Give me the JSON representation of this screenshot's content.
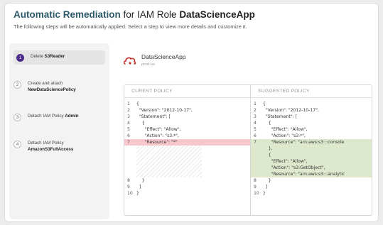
{
  "header": {
    "title_prefix": "Automatic Remediation",
    "title_middle": " for IAM Role ",
    "title_entity": "DataScienceApp",
    "subtitle": "The following steps will be automatically applied. Select a step to view more details and customize it."
  },
  "steps": [
    {
      "num": "1",
      "text": "Delete ",
      "bold": "S3Reader",
      "active": true
    },
    {
      "num": "2",
      "text": "Create and attach",
      "bold": "NewDataSciencePolicy",
      "active": false
    },
    {
      "num": "3",
      "text": "Detach IAM Policy ",
      "bold": "Admin",
      "active": false
    },
    {
      "num": "4",
      "text": "Detach IAM Policy",
      "bold": "AmazonS3FullAccess",
      "active": false
    }
  ],
  "app": {
    "name": "DataScienceApp",
    "region": "prod-us",
    "icon": "cloud-role-icon"
  },
  "current_policy": {
    "label": "CURENT POLICY",
    "lines": [
      {
        "n": "1",
        "t": "{"
      },
      {
        "n": "2",
        "t": "  \"Version\": \"2012-10-17\","
      },
      {
        "n": "3",
        "t": "  \"Statement\": ["
      },
      {
        "n": "4",
        "t": "    {"
      },
      {
        "n": "5",
        "t": "      \"Effect\": \"Allow\","
      },
      {
        "n": "6",
        "t": "      \"Action\": \"s3:*\","
      },
      {
        "n": "7",
        "t": "      \"Resource\": \"*\""
      },
      {
        "n": "8",
        "t": "    }"
      },
      {
        "n": "9",
        "t": "  ]"
      },
      {
        "n": "10",
        "t": "}"
      }
    ]
  },
  "suggested_policy": {
    "label": "SUGGESTED POLICY",
    "lines": [
      {
        "n": "1",
        "t": "{"
      },
      {
        "n": "2",
        "t": "  \"Version\": \"2012-10-17\","
      },
      {
        "n": "3",
        "t": "  \"Statement\": ["
      },
      {
        "n": "4",
        "t": "    {"
      },
      {
        "n": "5",
        "t": "      \"Effect\": \"Allow\","
      },
      {
        "n": "6",
        "t": "      \"Action\": \"s3:*\","
      },
      {
        "n": "7",
        "t": "      \"Resource\": \"arn:aws:s3:::console"
      },
      {
        "n": "",
        "t": "    },"
      },
      {
        "n": "",
        "t": "    {"
      },
      {
        "n": "",
        "t": "      \"Effect\": \"Allow\","
      },
      {
        "n": "",
        "t": "      \"Action\": \"s3:GetObject\","
      },
      {
        "n": "",
        "t": "      \"Resource\": \"arn:aws:s3:::analytic"
      },
      {
        "n": "8",
        "t": "    }"
      },
      {
        "n": "9",
        "t": "  ]"
      },
      {
        "n": "10",
        "t": "}"
      }
    ]
  },
  "colors": {
    "removed": "#f7c7cb",
    "added": "#dde8cc",
    "accent": "#2d5a6a",
    "active_step": "#4a2a8a",
    "logo": "#c0322b"
  }
}
